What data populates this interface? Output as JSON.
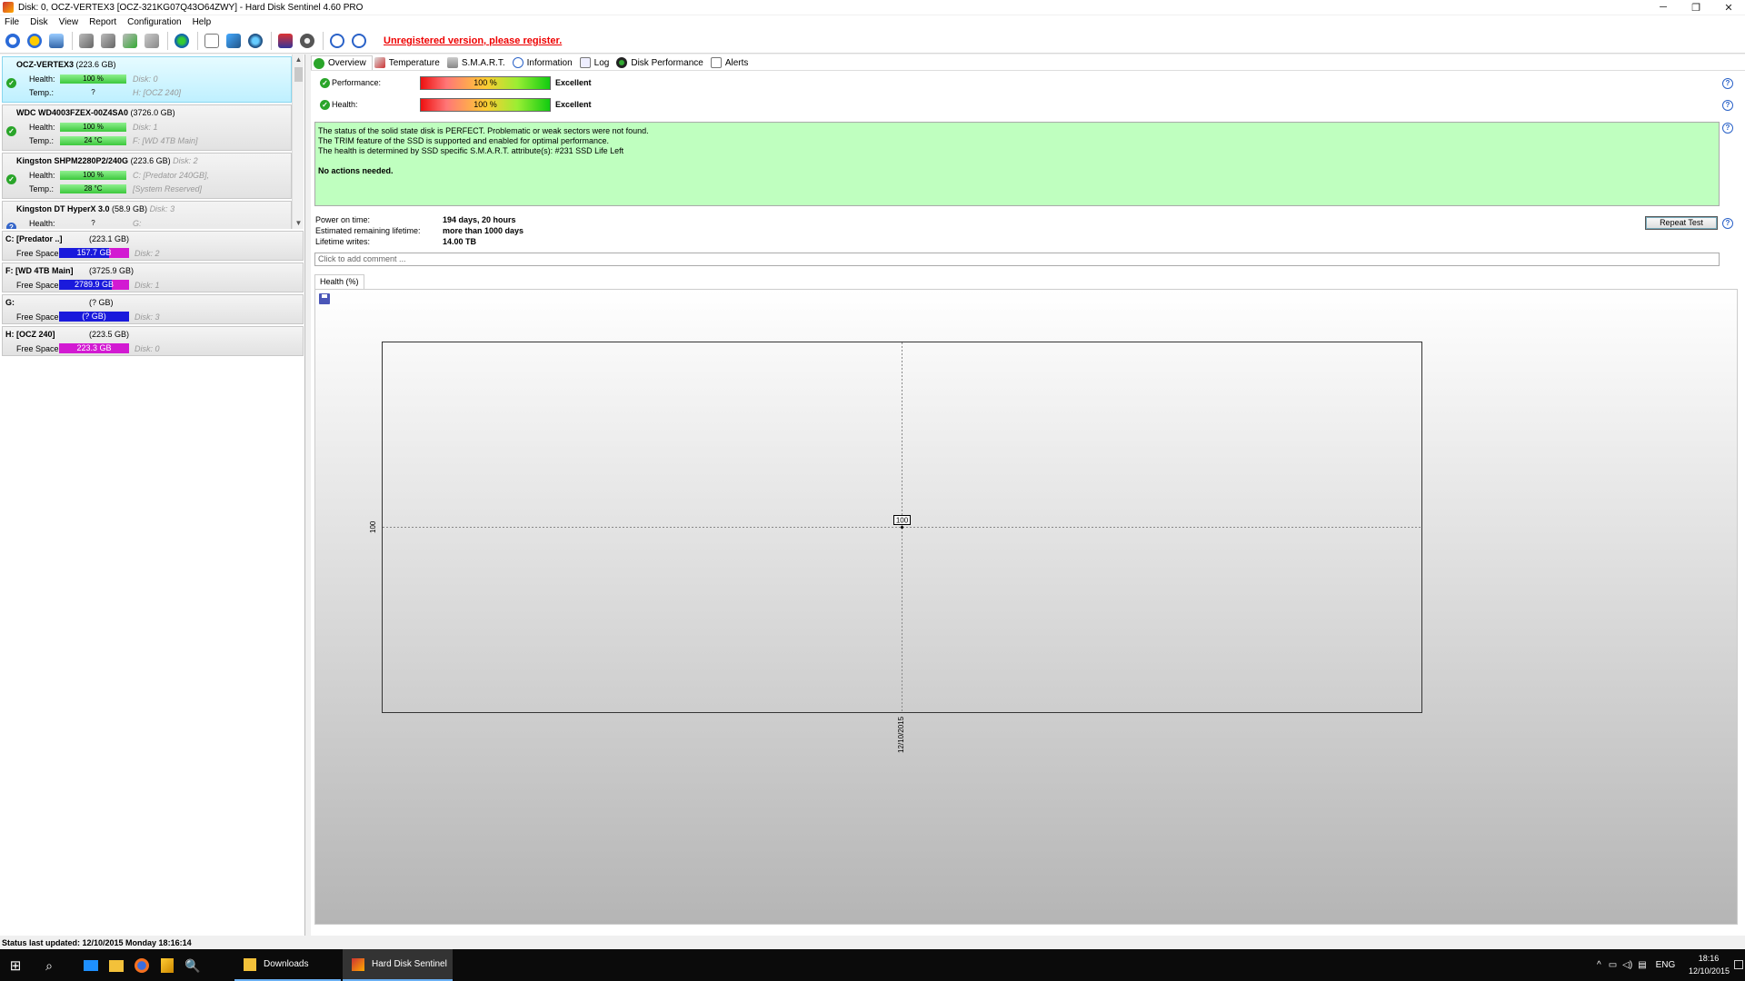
{
  "window": {
    "title": "Disk: 0, OCZ-VERTEX3 [OCZ-321KG07Q43O64ZWY]  -  Hard Disk Sentinel 4.60 PRO",
    "minimize": "─",
    "restore": "❐",
    "close": "✕"
  },
  "menu": [
    "File",
    "Disk",
    "View",
    "Report",
    "Configuration",
    "Help"
  ],
  "toolbar": {
    "unregistered": "Unregistered version, please register."
  },
  "disks": [
    {
      "name": "OCZ-VERTEX3",
      "capacity": "(223.6 GB)",
      "disk_no": "",
      "health_label": "Health:",
      "health": "100 %",
      "health_pct": 100,
      "health_extra": "Disk: 0",
      "temp_label": "Temp.:",
      "temp": "?",
      "temp_extra": "H: [OCZ 240]",
      "status": "ok"
    },
    {
      "name": "WDC WD4003FZEX-00Z4SA0",
      "capacity": "(3726.0 GB)",
      "disk_no": "",
      "health_label": "Health:",
      "health": "100 %",
      "health_pct": 100,
      "health_extra": "Disk: 1",
      "temp_label": "Temp.:",
      "temp": "24 °C",
      "temp_extra": "F: [WD 4TB Main]",
      "status": "ok"
    },
    {
      "name": "Kingston SHPM2280P2/240G",
      "capacity": "(223.6 GB)",
      "disk_no": "Disk: 2",
      "health_label": "Health:",
      "health": "100 %",
      "health_pct": 100,
      "health_extra": "C: [Predator 240GB],",
      "temp_label": "Temp.:",
      "temp": "28 °C",
      "temp_extra": "[System Reserved]",
      "status": "ok"
    },
    {
      "name": "Kingston DT HyperX 3.0",
      "capacity": "(58.9 GB)",
      "disk_no": "Disk: 3",
      "health_label": "Health:",
      "health": "?",
      "health_pct": 0,
      "health_extra": "G:",
      "temp_label": "",
      "temp": "",
      "temp_extra": "",
      "status": "unknown"
    }
  ],
  "volumes": [
    {
      "name": "C: [Predator ..]",
      "capacity": "(223.1 GB)",
      "free_label": "Free Space",
      "free": "157.7 GB",
      "used_fraction": 0.29,
      "disk": "Disk: 2"
    },
    {
      "name": "F: [WD 4TB Main]",
      "capacity": "(3725.9 GB)",
      "free_label": "Free Space",
      "free": "2789.9 GB",
      "used_fraction": 0.25,
      "disk": "Disk: 1"
    },
    {
      "name": "G:",
      "capacity": "(? GB)",
      "free_label": "Free Space",
      "free": "(? GB)",
      "used_fraction": 0,
      "disk": "Disk: 3"
    },
    {
      "name": "H: [OCZ 240]",
      "capacity": "(223.5 GB)",
      "free_label": "Free Space",
      "free": "223.3 GB",
      "used_fraction": 1,
      "disk": "Disk: 0"
    }
  ],
  "tabs": [
    "Overview",
    "Temperature",
    "S.M.A.R.T.",
    "Information",
    "Log",
    "Disk Performance",
    "Alerts"
  ],
  "overview": {
    "performance_label": "Performance:",
    "performance_value": "100 %",
    "performance_rating": "Excellent",
    "health_label": "Health:",
    "health_value": "100 %",
    "health_rating": "Excellent",
    "status_lines": [
      "The status of the solid state disk is PERFECT. Problematic or weak sectors were not found.",
      "The TRIM feature of the SSD is supported and enabled for optimal performance.",
      "The health is determined by SSD specific S.M.A.R.T. attribute(s):  #231 SSD Life Left"
    ],
    "actions": "No actions needed.",
    "power_on_label": "Power on time:",
    "power_on_value": "194 days, 20 hours",
    "remaining_label": "Estimated remaining lifetime:",
    "remaining_value": "more than 1000 days",
    "writes_label": "Lifetime writes:",
    "writes_value": "14.00 TB",
    "repeat_button": "Repeat Test",
    "comment_placeholder": "Click to add comment ...",
    "help": "?"
  },
  "health_tab": "Health (%)",
  "chart_data": {
    "type": "line",
    "title": "",
    "xlabel": "",
    "ylabel": "",
    "x": [
      "12/10/2015"
    ],
    "y_ticks": [
      "100"
    ],
    "series": [
      {
        "values": [
          100
        ]
      }
    ],
    "point_labels": [
      "100"
    ],
    "grid": true
  },
  "statusbar": "Status last updated: 12/10/2015 Monday 18:16:14",
  "taskbar": {
    "tasks": [
      "Downloads",
      "Hard Disk Sentinel"
    ],
    "lang": "ENG",
    "time": "18:16",
    "date": "12/10/2015"
  },
  "colors": {
    "selected_disk_bg": "#bff0ff",
    "status_ok_bg": "#bfffbf",
    "free_space_blue": "#1a1adc",
    "free_space_magenta": "#d21ad2",
    "unregistered_red": "#e00000"
  }
}
